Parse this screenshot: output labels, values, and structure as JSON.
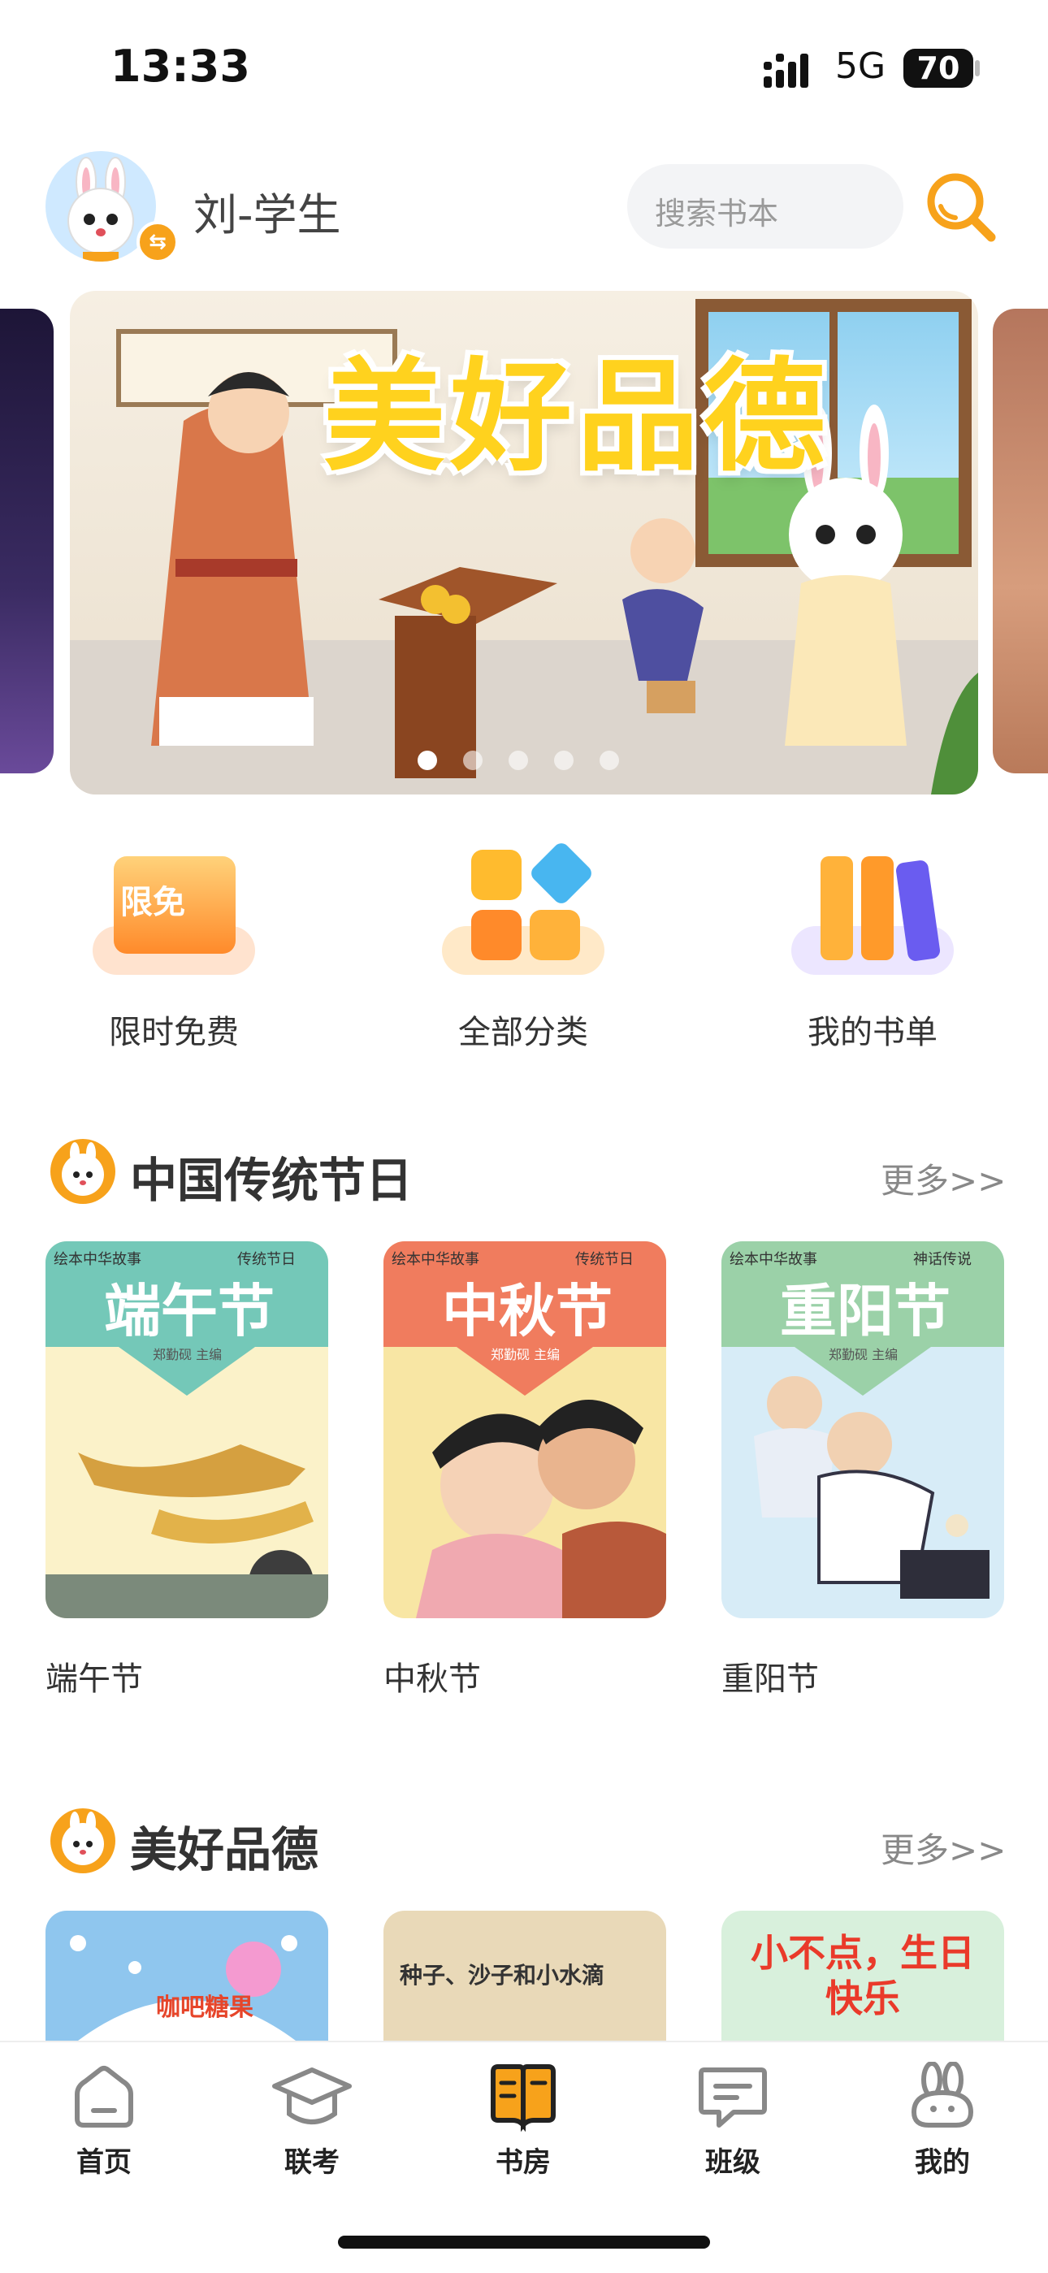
{
  "status": {
    "time": "13:33",
    "network": "5G",
    "battery": "70"
  },
  "header": {
    "username": "刘-学生",
    "search_placeholder": "搜索书本"
  },
  "banner": {
    "title": "美好品德",
    "page_count": 5,
    "active_page": 1
  },
  "quick_entries": [
    {
      "label": "限时免费",
      "badge": "限免"
    },
    {
      "label": "全部分类"
    },
    {
      "label": "我的书单"
    }
  ],
  "sections": [
    {
      "title": "中国传统节日",
      "more": "更多>>",
      "books": [
        {
          "name": "端午节",
          "cover_title": "端午节",
          "cover_top": "绘本中华故事",
          "cover_tag": "传统节日",
          "cover_editor": "郑勤砚 主编"
        },
        {
          "name": "中秋节",
          "cover_title": "中秋节",
          "cover_top": "绘本中华故事",
          "cover_tag": "传统节日",
          "cover_editor": "郑勤砚 主编"
        },
        {
          "name": "重阳节",
          "cover_title": "重阳节",
          "cover_top": "绘本中华故事",
          "cover_tag": "神话传说",
          "cover_editor": "郑勤砚 主编"
        }
      ]
    },
    {
      "title": "美好品德",
      "more": "更多>>",
      "books": [
        {
          "cover_title": "咖吧糖果"
        },
        {
          "cover_title": "种子、沙子和小水滴"
        },
        {
          "cover_title": "小不点，生日快乐"
        }
      ]
    }
  ],
  "tabbar": [
    {
      "label": "首页",
      "icon": "home-icon"
    },
    {
      "label": "联考",
      "icon": "graduation-cap-icon"
    },
    {
      "label": "书房",
      "icon": "book-icon",
      "active": true
    },
    {
      "label": "班级",
      "icon": "chat-bubble-icon"
    },
    {
      "label": "我的",
      "icon": "rabbit-icon"
    }
  ],
  "colors": {
    "accent": "#f7a21b",
    "banner_title": "#ffd21e"
  }
}
